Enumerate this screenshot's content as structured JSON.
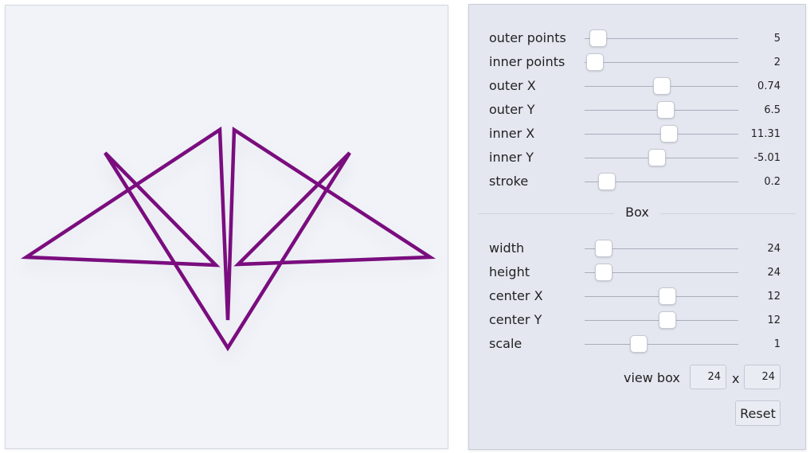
{
  "colors": {
    "stroke": "#7a0a7e",
    "canvas_bg": "#f1f3f9",
    "panel_bg": "#e4e7f0"
  },
  "star_sliders": [
    {
      "label": "outer points",
      "value": "5",
      "fraction": 0.09
    },
    {
      "label": "inner points",
      "value": "2",
      "fraction": 0.065
    },
    {
      "label": "outer X",
      "value": "0.74",
      "fraction": 0.5
    },
    {
      "label": "outer Y",
      "value": "6.5",
      "fraction": 0.53
    },
    {
      "label": "inner X",
      "value": "11.31",
      "fraction": 0.55
    },
    {
      "label": "inner Y",
      "value": "-5.01",
      "fraction": 0.47
    },
    {
      "label": "stroke",
      "value": "0.2",
      "fraction": 0.145
    }
  ],
  "box_section": {
    "title": "Box"
  },
  "box_sliders": [
    {
      "label": "width",
      "value": "24",
      "fraction": 0.125
    },
    {
      "label": "height",
      "value": "24",
      "fraction": 0.125
    },
    {
      "label": "center X",
      "value": "12",
      "fraction": 0.54
    },
    {
      "label": "center Y",
      "value": "12",
      "fraction": 0.54
    },
    {
      "label": "scale",
      "value": "1",
      "fraction": 0.35
    }
  ],
  "view_box": {
    "label": "view box",
    "width": "24",
    "height": "24",
    "separator": "x"
  },
  "reset_label": "Reset"
}
